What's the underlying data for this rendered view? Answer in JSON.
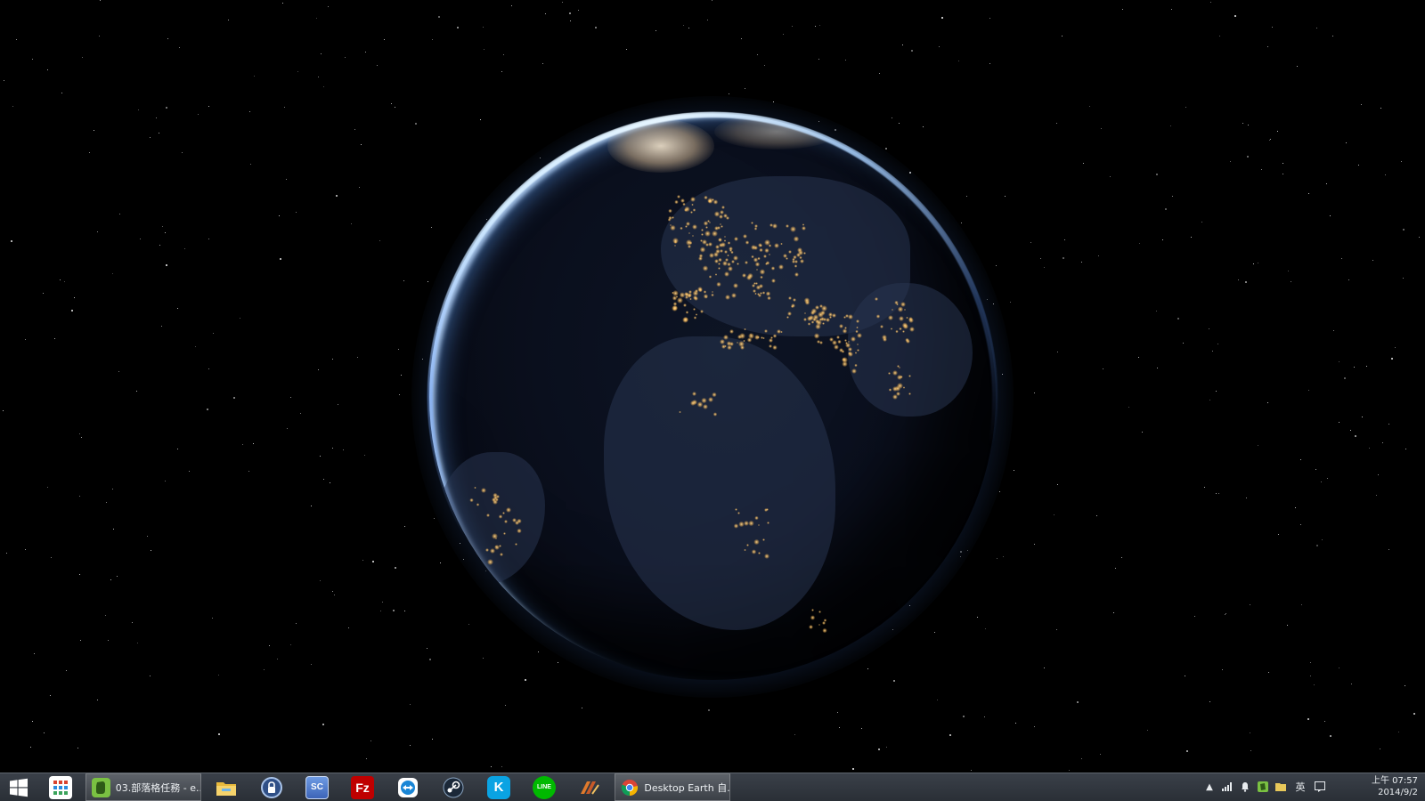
{
  "desktop": {
    "wallpaper": "Earth at night from space with star field"
  },
  "taskbar": {
    "start_icon": "windows-logo-icon",
    "pinned": [
      {
        "name": "apps-grid-icon",
        "color": "#ffffff"
      },
      {
        "name": "evernote-icon",
        "color": "#7ac142"
      },
      {
        "name": "file-explorer-icon",
        "color": "#f2c94c"
      },
      {
        "name": "keepass-lock-icon",
        "color": "#3a6fb0"
      },
      {
        "name": "screen-capture-icon",
        "color": "#4a7bd0",
        "text": "SC"
      },
      {
        "name": "filezilla-icon",
        "color": "#bf0000",
        "text": "Fz"
      },
      {
        "name": "teamviewer-icon",
        "color": "#1a86d6"
      },
      {
        "name": "steam-icon",
        "color": "#1b2838"
      },
      {
        "name": "kkbox-icon",
        "color": "#0aa3e3",
        "text": "K"
      },
      {
        "name": "line-icon",
        "color": "#00b900",
        "text": "LINE"
      },
      {
        "name": "editor-icon",
        "color": "#c85a28"
      },
      {
        "name": "chrome-icon",
        "color": "#db4437"
      }
    ],
    "windows": [
      {
        "label": "03.部落格任務 - e...",
        "icon": "evernote-icon"
      },
      {
        "label": "Desktop Earth 自...",
        "icon": "chrome-icon"
      }
    ]
  },
  "tray": {
    "show_hidden_icon": "chevron-up-icon",
    "ime": "英",
    "clock_time": "上午 07:57",
    "clock_date": "2014/9/2"
  }
}
